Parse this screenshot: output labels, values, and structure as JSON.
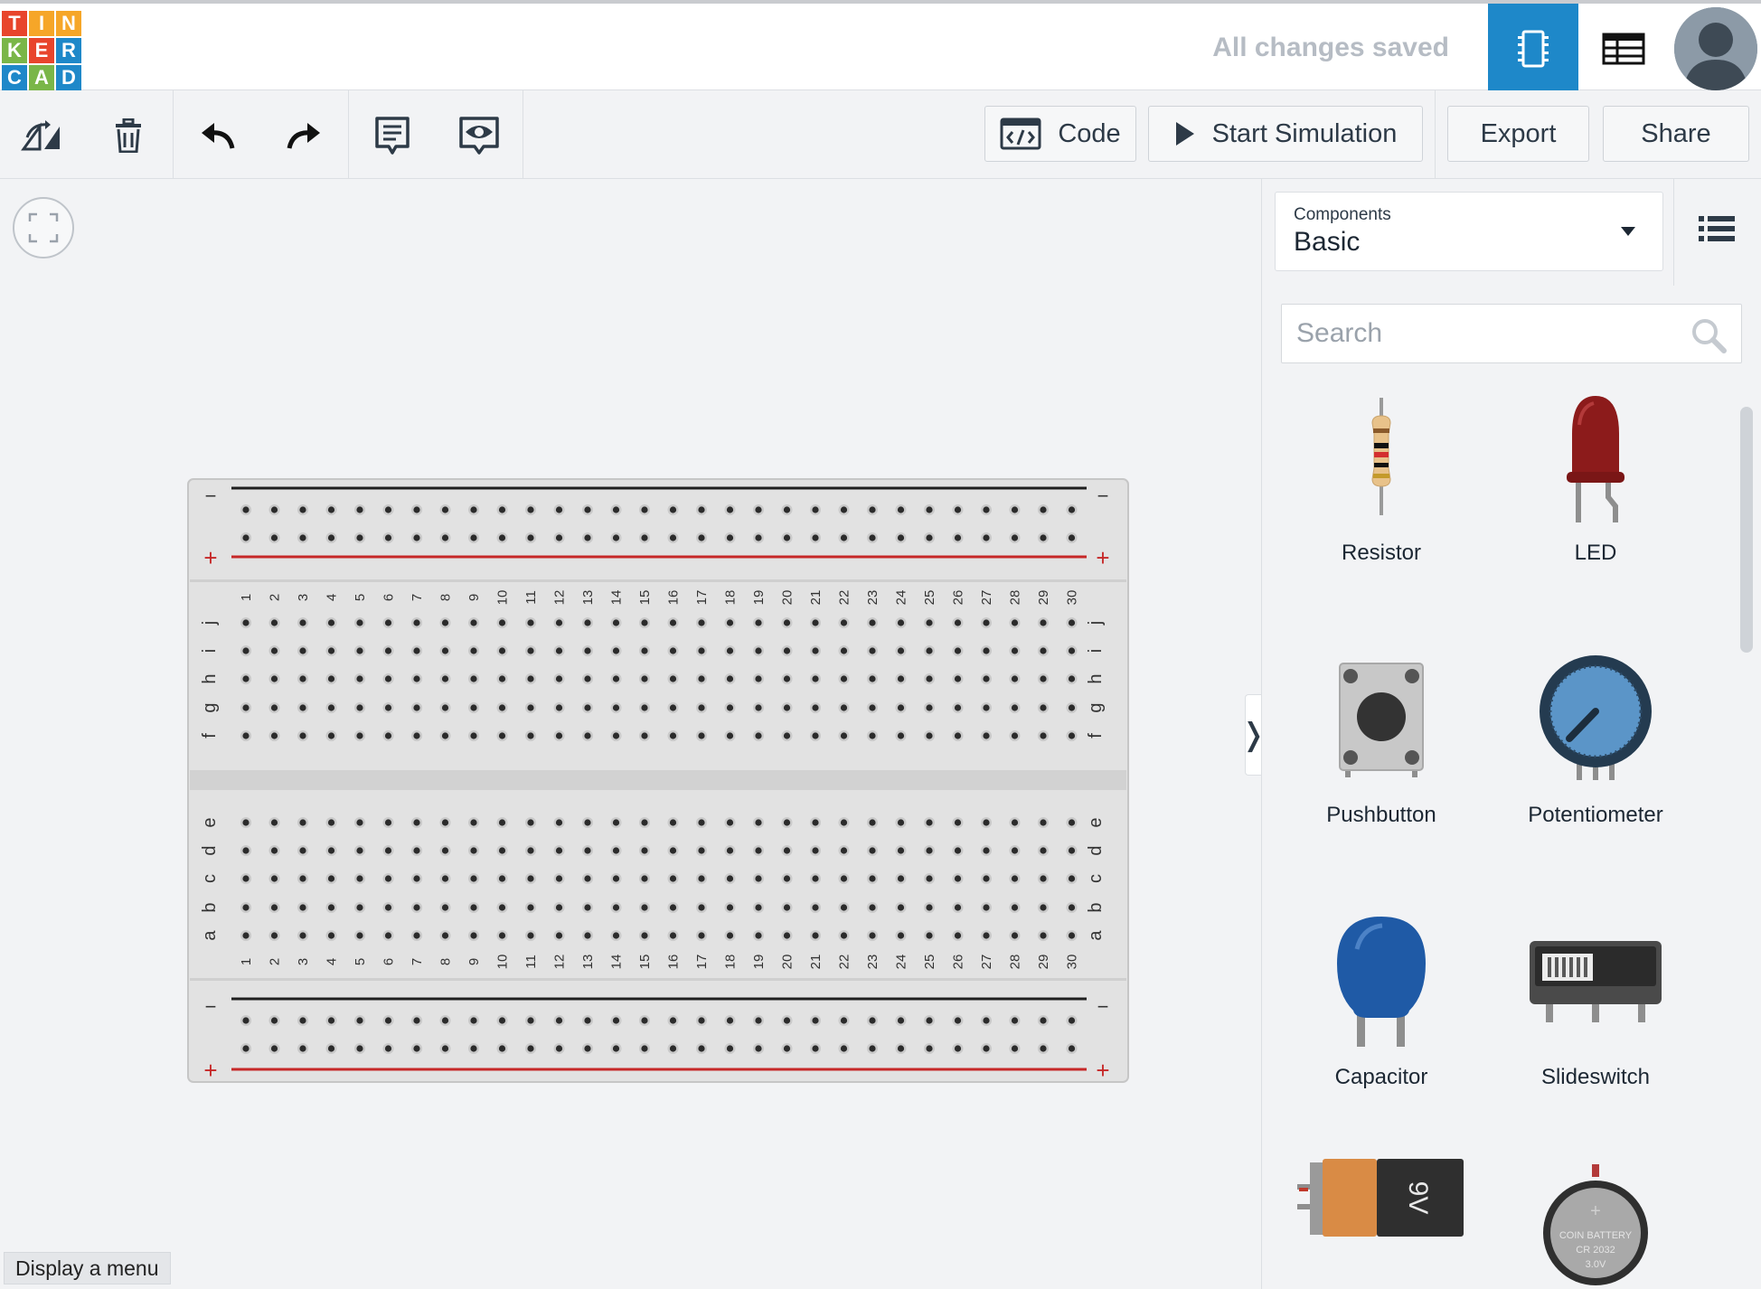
{
  "header": {
    "logo_letters": [
      "T",
      "I",
      "N",
      "K",
      "E",
      "R",
      "C",
      "A",
      "D"
    ],
    "logo_colors": [
      "#e8452c",
      "#f6a628",
      "#f6a628",
      "#7ab648",
      "#e8452c",
      "#1e88c9",
      "#1e88c9",
      "#7ab648",
      "#1e88c9"
    ],
    "status": "All changes saved",
    "circuit_view_icon": "breadboard-icon",
    "list_view_icon": "schematic-table-icon",
    "avatar_icon": "user-avatar"
  },
  "toolbar": {
    "tools": [
      {
        "name": "rotate-icon"
      },
      {
        "name": "delete-icon"
      },
      {
        "name": "undo-icon"
      },
      {
        "name": "redo-icon"
      },
      {
        "name": "notes-icon"
      },
      {
        "name": "visibility-icon"
      }
    ],
    "code_label": "Code",
    "simulation_label": "Start Simulation",
    "export_label": "Export",
    "share_label": "Share"
  },
  "canvas": {
    "fit_icon": "fit-view-icon",
    "display_menu": "Display a menu",
    "collapse_glyph": "❭"
  },
  "breadboard": {
    "columns": [
      "1",
      "2",
      "3",
      "4",
      "5",
      "6",
      "7",
      "8",
      "9",
      "10",
      "11",
      "12",
      "13",
      "14",
      "15",
      "16",
      "17",
      "18",
      "19",
      "20",
      "21",
      "22",
      "23",
      "24",
      "25",
      "26",
      "27",
      "28",
      "29",
      "30"
    ],
    "top_rows": [
      "j",
      "i",
      "h",
      "g",
      "f"
    ],
    "bottom_rows": [
      "e",
      "d",
      "c",
      "b",
      "a"
    ],
    "rail_minus": "−",
    "rail_plus": "+",
    "colors": {
      "board": "#e2e2e2",
      "hole": "#2b2b2b",
      "minus_line": "#1f1f1f",
      "plus_line": "#c62828"
    }
  },
  "panel": {
    "category_caption": "Components",
    "category_value": "Basic",
    "search_placeholder": "Search",
    "components": [
      {
        "label": "Resistor",
        "icon": "resistor-icon"
      },
      {
        "label": "LED",
        "icon": "led-icon"
      },
      {
        "label": "Pushbutton",
        "icon": "pushbutton-icon"
      },
      {
        "label": "Potentiometer",
        "icon": "potentiometer-icon"
      },
      {
        "label": "Capacitor",
        "icon": "capacitor-icon"
      },
      {
        "label": "Slideswitch",
        "icon": "slideswitch-icon"
      },
      {
        "label": "",
        "icon": "battery-9v-icon",
        "text": "9V"
      },
      {
        "label": "",
        "icon": "coin-battery-icon",
        "text_lines": [
          "COIN BATTERY",
          "CR 2032",
          "3.0V"
        ]
      }
    ]
  }
}
